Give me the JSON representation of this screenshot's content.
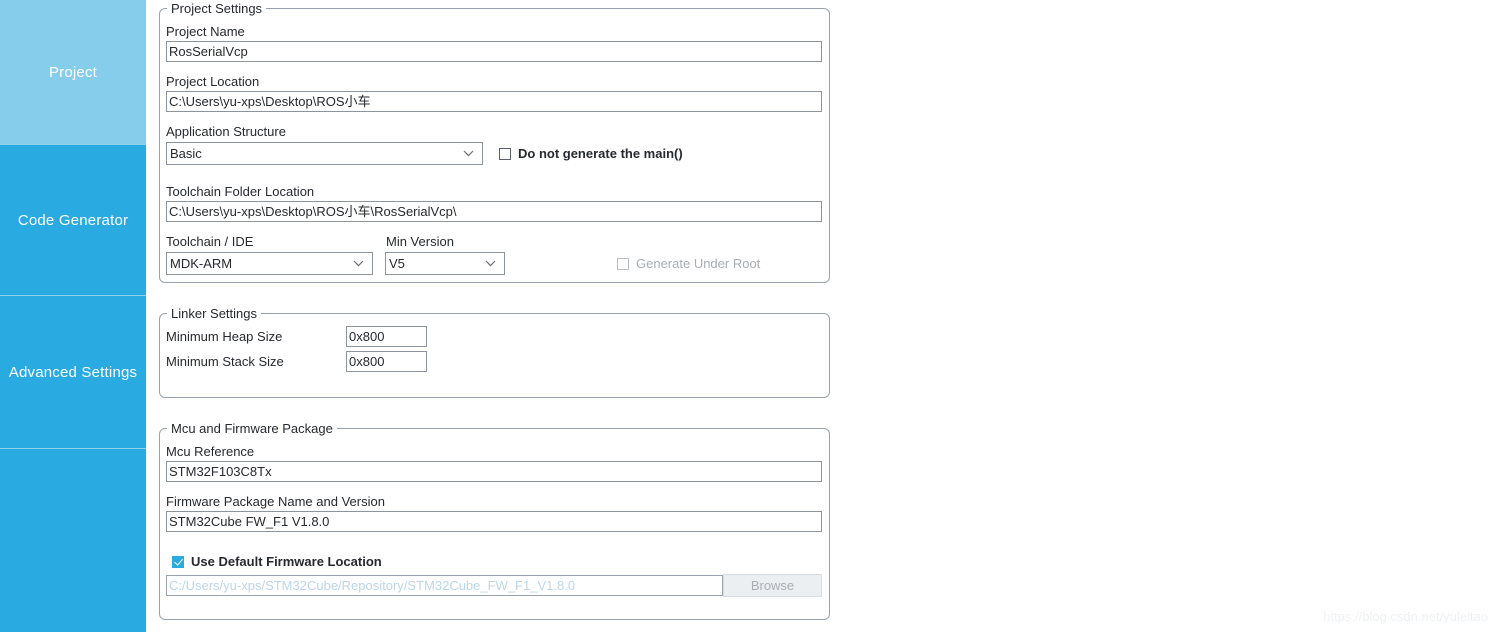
{
  "sidebar": {
    "items": [
      {
        "label": "Project",
        "selected": true
      },
      {
        "label": "Code Generator",
        "selected": false
      },
      {
        "label": "Advanced Settings",
        "selected": false
      },
      {
        "label": "",
        "selected": false
      }
    ]
  },
  "project_settings": {
    "title": "Project Settings",
    "project_name_label": "Project Name",
    "project_name_value": "RosSerialVcp",
    "project_location_label": "Project Location",
    "project_location_value": "C:\\Users\\yu-xps\\Desktop\\ROS小车",
    "application_structure_label": "Application Structure",
    "application_structure_value": "Basic",
    "do_not_generate_main_label": "Do not generate the main()",
    "do_not_generate_main_checked": false,
    "toolchain_folder_label": "Toolchain Folder Location",
    "toolchain_folder_value": "C:\\Users\\yu-xps\\Desktop\\ROS小车\\RosSerialVcp\\",
    "toolchain_ide_label": "Toolchain / IDE",
    "toolchain_ide_value": "MDK-ARM",
    "min_version_label": "Min Version",
    "min_version_value": "V5",
    "generate_under_root_label": "Generate Under Root",
    "generate_under_root_checked": false
  },
  "linker_settings": {
    "title": "Linker Settings",
    "min_heap_label": "Minimum Heap Size",
    "min_heap_value": "0x800",
    "min_stack_label": "Minimum Stack Size",
    "min_stack_value": "0x800"
  },
  "mcu_firmware": {
    "title": "Mcu and Firmware Package",
    "mcu_reference_label": "Mcu Reference",
    "mcu_reference_value": "STM32F103C8Tx",
    "firmware_package_label": "Firmware Package Name and Version",
    "firmware_package_value": "STM32Cube FW_F1 V1.8.0",
    "use_default_location_label": "Use Default Firmware Location",
    "use_default_location_checked": true,
    "firmware_location_value": "C:/Users/yu-xps/STM32Cube/Repository/STM32Cube_FW_F1_V1.8.0",
    "browse_label": "Browse"
  },
  "watermark": "https://blog.csdn.net/yuleitao",
  "colors": {
    "sidebar": "#29abe2",
    "sidebar_selected": "#86cdeb",
    "checkbox_accent": "#29abe2",
    "border": "#9aa3ad"
  }
}
